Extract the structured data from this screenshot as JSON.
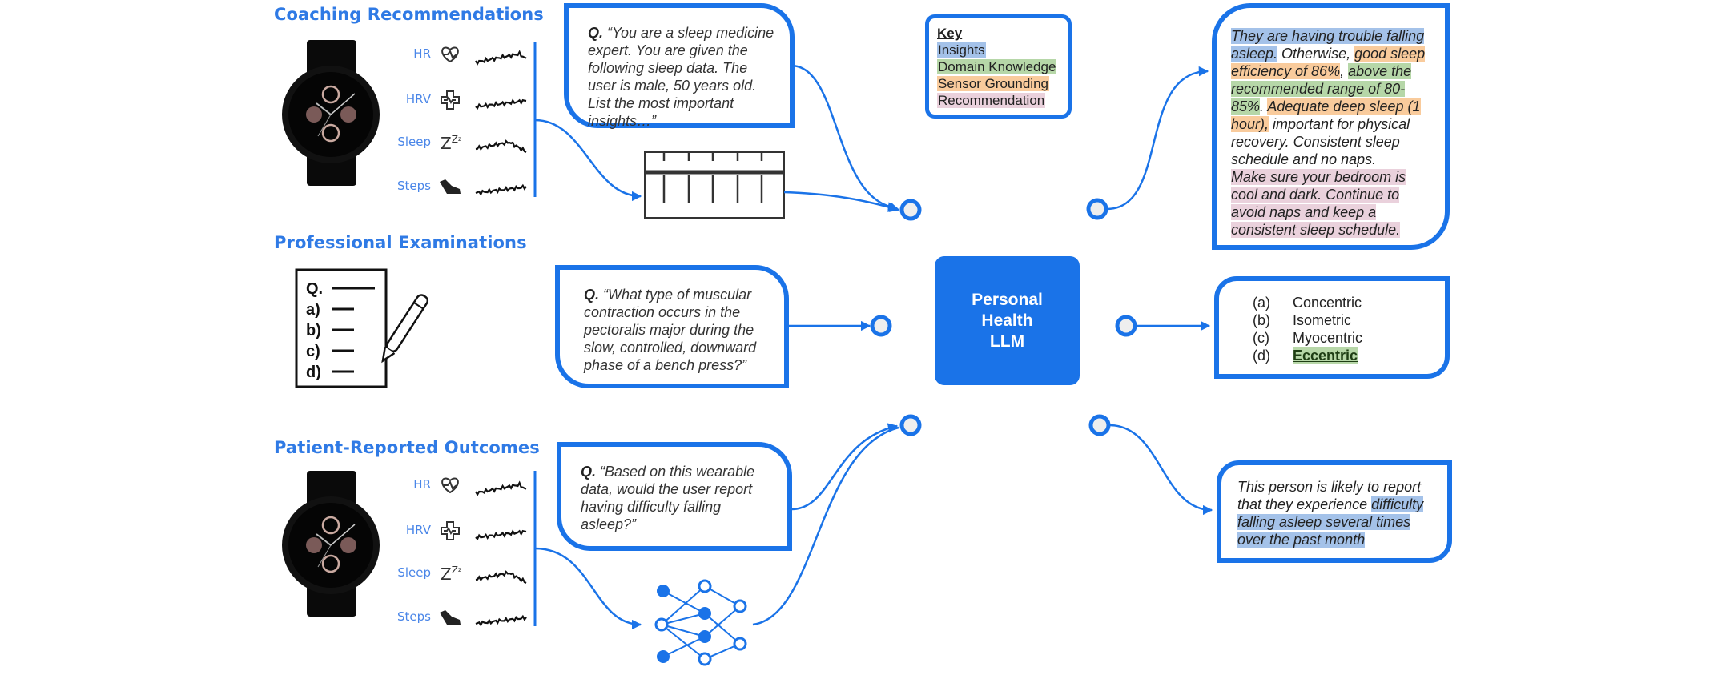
{
  "sections": {
    "coaching": {
      "title": "Coaching Recommendations"
    },
    "exams": {
      "title": "Professional Examinations"
    },
    "outcomes": {
      "title": "Patient-Reported Outcomes"
    }
  },
  "metrics": [
    {
      "label": "HR",
      "icon": "heart-pulse-icon"
    },
    {
      "label": "HRV",
      "icon": "medical-cross-icon"
    },
    {
      "label": "Sleep",
      "icon": "sleep-zzz-icon"
    },
    {
      "label": "Steps",
      "icon": "sneaker-icon"
    }
  ],
  "exam_icon": {
    "lines": [
      "Q.",
      "a)",
      "b)",
      "c)",
      "d)"
    ]
  },
  "questions": {
    "coaching": {
      "prefix": "Q.",
      "text": "“You are a sleep medicine expert. You are given the following sleep data. The user is male, 50 years old.  List the most important insights…”"
    },
    "exams": {
      "prefix": "Q.",
      "text": "“What type of muscular contraction occurs in the pectoralis major during the slow, controlled, downward phase of a bench press?”"
    },
    "outcomes": {
      "prefix": "Q.",
      "text": "“Based on this wearable data, would the user report having difficulty falling asleep?”"
    }
  },
  "key": {
    "title": "Key",
    "items": [
      {
        "label": "Insights",
        "color": "#a4c2e9"
      },
      {
        "label": "Domain Knowledge",
        "color": "#b6d7a8"
      },
      {
        "label": "Sensor Grounding",
        "color": "#f9cb9c"
      },
      {
        "label": "Recommendation",
        "color": "#ead1dc"
      }
    ]
  },
  "model": {
    "line1": "Personal",
    "line2": "Health",
    "line3": "LLM",
    "color": "#1a73e8"
  },
  "answers": {
    "coaching": {
      "segments": [
        {
          "text": " They are having trouble falling asleep.",
          "type": "ins"
        },
        {
          "text": " Otherwise, ",
          "type": "none"
        },
        {
          "text": "good sleep efficiency of 86%",
          "type": "sen"
        },
        {
          "text": ", ",
          "type": "none"
        },
        {
          "text": "above the recommended range of 80-85%",
          "type": "dom"
        },
        {
          "text": ". ",
          "type": "none"
        },
        {
          "text": "Adequate deep sleep (1 hour),",
          "type": "sen"
        },
        {
          "text": " important for physical recovery. Consistent sleep schedule and no naps.",
          "type": "none"
        },
        {
          "text": "Make sure your bedroom is cool and dark. Continue to avoid naps and keep a consistent sleep schedule.",
          "type": "rec",
          "newline": true
        }
      ]
    },
    "exams": {
      "options": [
        {
          "letter": "(a)",
          "text": "Concentric",
          "correct": false
        },
        {
          "letter": "(b)",
          "text": "Isometric",
          "correct": false
        },
        {
          "letter": "(c)",
          "text": "Myocentric",
          "correct": false
        },
        {
          "letter": "(d)",
          "text": "Eccentric",
          "correct": true
        }
      ]
    },
    "outcomes": {
      "segments": [
        {
          "text": " This person is likely to report that they experience ",
          "type": "none"
        },
        {
          "text": "difficulty falling asleep several times over the past month",
          "type": "ins"
        }
      ]
    }
  },
  "colors": {
    "accent": "#1a73e8",
    "section_title": "#2f7ae5",
    "metric_label": "#4a86e8"
  }
}
